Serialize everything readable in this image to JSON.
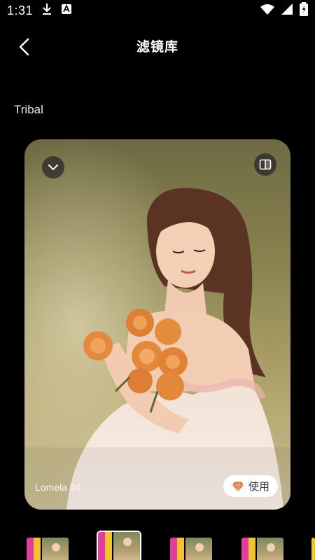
{
  "status_bar": {
    "time": "1:31",
    "icons": [
      "download-icon",
      "a-badge-icon",
      "wifi-icon",
      "signal-icon",
      "battery-icon"
    ]
  },
  "header": {
    "title": "滤镜库",
    "back_icon": "chevron-left-icon"
  },
  "section": {
    "label": "Tribal"
  },
  "preview": {
    "filter_name": "Lomela 04",
    "use_label": "使用",
    "collapse_icon": "chevron-down-icon",
    "compare_icon": "compare-icon",
    "premium_icon": "diamond-icon"
  },
  "thumbnails": [
    {
      "selected": false
    },
    {
      "selected": true
    },
    {
      "selected": false
    },
    {
      "selected": false
    }
  ],
  "colors": {
    "background": "#000000",
    "accent_pink": "#e23c9c",
    "accent_yellow": "#f1c333",
    "use_button_bg": "#ffffff",
    "diamond": "#d77a4a"
  }
}
